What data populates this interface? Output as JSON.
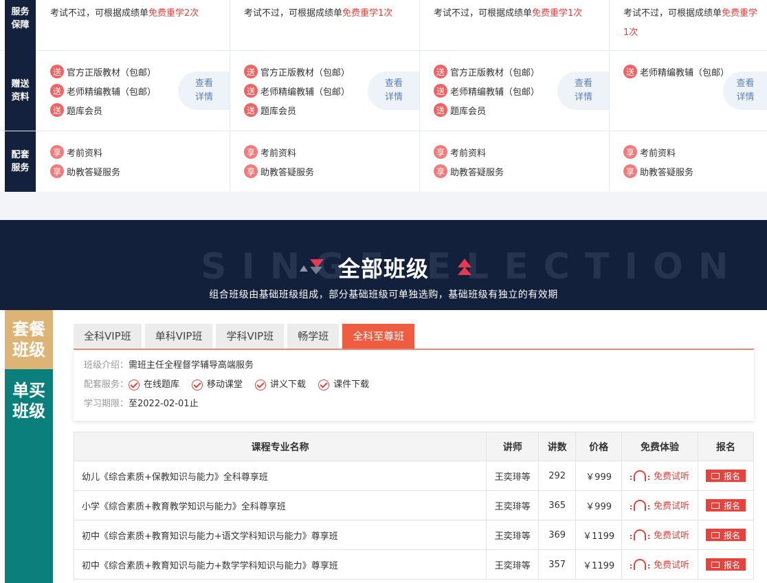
{
  "compare": {
    "rows": [
      {
        "head": "服务保障",
        "head_visible": "服务 保障"
      },
      {
        "head": "赠送资料"
      },
      {
        "head": "配套服务"
      }
    ],
    "service": [
      {
        "text": "考试不过，可根据成绩单",
        "highlight": "免费重学2次"
      },
      {
        "text": "考试不过，可根据成绩单",
        "highlight": "免费重学1次"
      },
      {
        "text": "考试不过，可根据成绩单",
        "highlight": "免费重学1次"
      },
      {
        "text": "考试不过，可根据成绩单",
        "highlight": "免费重学1次"
      }
    ],
    "gift_badge": "送",
    "gifts": [
      [
        "官方正版教材（包邮）",
        "老师精编教辅（包邮）",
        "题库会员"
      ],
      [
        "官方正版教材（包邮）",
        "老师精编教辅（包邮）",
        "题库会员"
      ],
      [
        "官方正版教材（包邮）",
        "老师精编教辅（包邮）",
        "题库会员"
      ],
      [
        "老师精编教辅（包邮）"
      ]
    ],
    "detail_label": "查看详情",
    "svc_badge": "享",
    "services": [
      "考前资料",
      "助教答疑服务"
    ]
  },
  "hero": {
    "watermark": "SINGE ELECTION",
    "title": "全部班级",
    "subtitle": "组合班级由基础班级组成，部分基础班级可单独选购，基础班级有独立的有效期"
  },
  "side": {
    "combo": "套餐班级",
    "single": "单买班级"
  },
  "tabs": [
    {
      "label": "全科VIP班",
      "active": false
    },
    {
      "label": "单科VIP班",
      "active": false
    },
    {
      "label": "学科VIP班",
      "active": false
    },
    {
      "label": "畅学班",
      "active": false
    },
    {
      "label": "全科至尊班",
      "active": true
    }
  ],
  "info": {
    "intro_label": "班级介绍：",
    "intro_value": "需班主任全程督学辅导高端服务",
    "svc_label": "配套服务：",
    "svc_items": [
      "在线题库",
      "移动课堂",
      "讲义下载",
      "课件下载"
    ],
    "period_label": "学习期限：",
    "period_value": "至2022-02-01止"
  },
  "table": {
    "headers": [
      "课程专业名称",
      "讲师",
      "讲数",
      "价格",
      "免费体验",
      "报名"
    ],
    "trial_label": "免费试听",
    "enroll_label": "报名",
    "rows": [
      {
        "name": "幼儿《综合素质+保教知识与能力》全科尊享班",
        "teacher": "王奕琲等",
        "lessons": "292",
        "price": "￥999"
      },
      {
        "name": "小学《综合素质+教育教学知识与能力》全科尊享班",
        "teacher": "王奕琲等",
        "lessons": "365",
        "price": "￥999"
      },
      {
        "name": "初中《综合素质+教育知识与能力+语文学科知识与能力》尊享班",
        "teacher": "王奕琲等",
        "lessons": "369",
        "price": "￥1199"
      },
      {
        "name": "初中《综合素质+教育知识与能力+数学学科知识与能力》尊享班",
        "teacher": "王奕琲等",
        "lessons": "357",
        "price": "￥1199"
      }
    ]
  },
  "colors": {
    "navy": "#14213d",
    "accent_red": "#e8423d",
    "tab_active": "#f05c3f",
    "gold": "#dcb576",
    "teal": "#0b7f7b"
  }
}
